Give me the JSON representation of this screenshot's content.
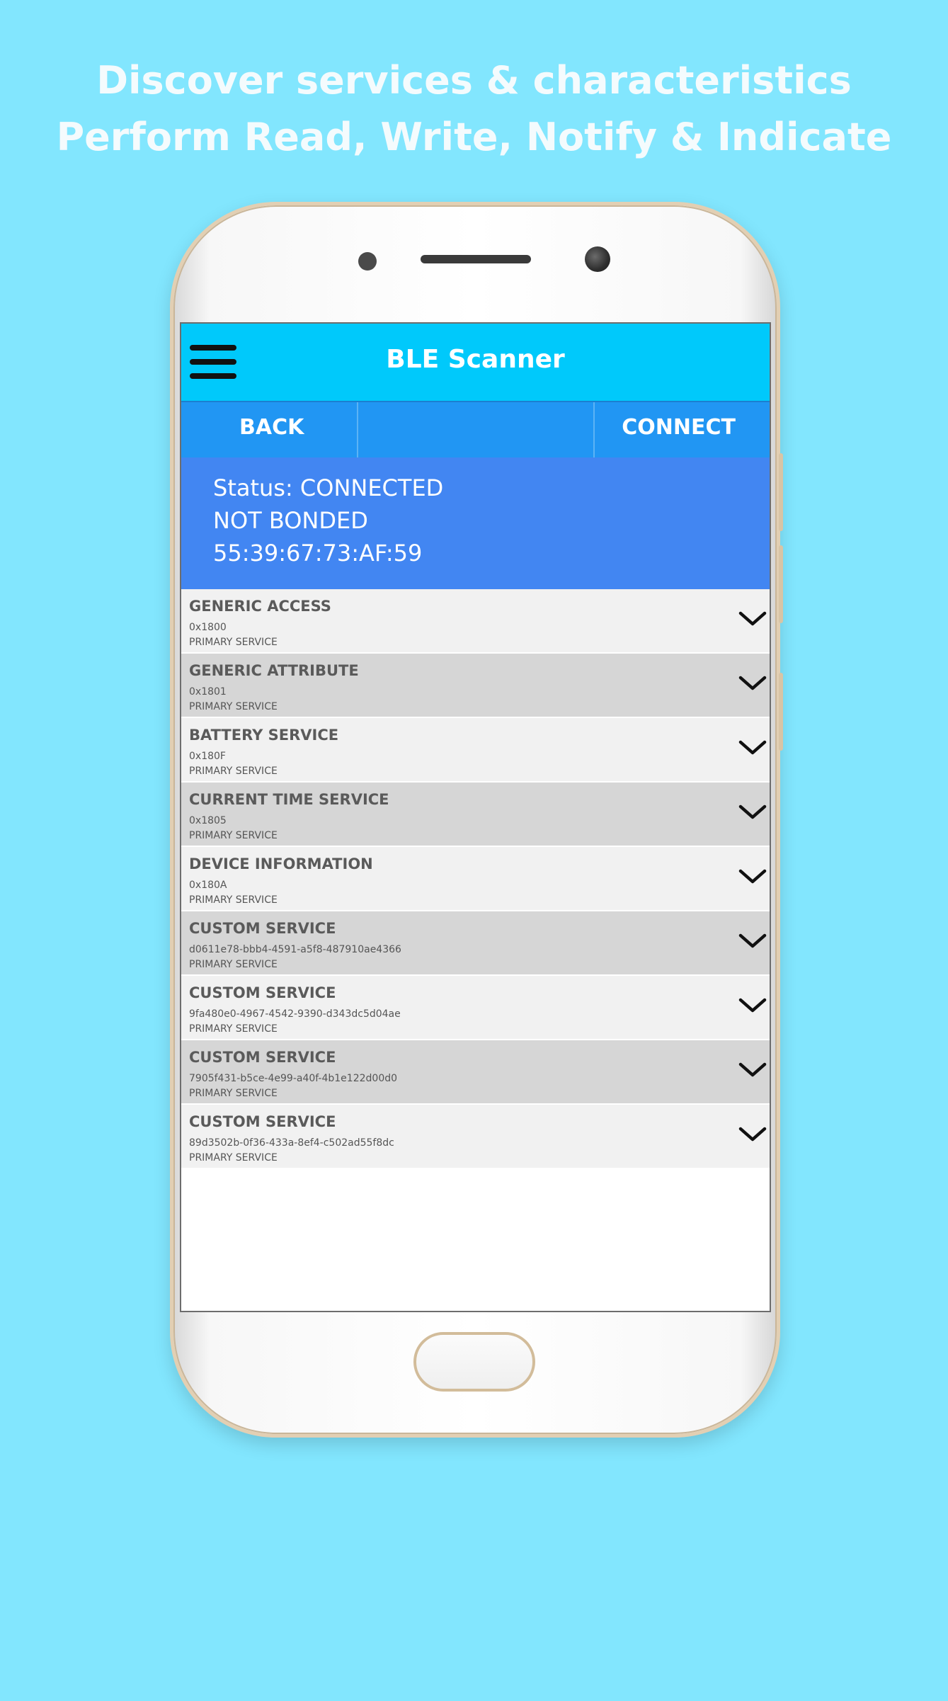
{
  "promo": {
    "line1": "Discover services & characteristics",
    "line2": "Perform Read, Write, Notify & Indicate"
  },
  "app": {
    "title": "BLE Scanner",
    "back_label": "BACK",
    "connect_label": "CONNECT"
  },
  "status": {
    "state": "Status: CONNECTED",
    "bond": "NOT BONDED",
    "address": "55:39:67:73:AF:59"
  },
  "services": [
    {
      "name": "GENERIC ACCESS",
      "uuid": "0x1800",
      "type": "PRIMARY SERVICE"
    },
    {
      "name": "GENERIC ATTRIBUTE",
      "uuid": "0x1801",
      "type": "PRIMARY SERVICE"
    },
    {
      "name": "BATTERY SERVICE",
      "uuid": "0x180F",
      "type": "PRIMARY SERVICE"
    },
    {
      "name": "CURRENT TIME SERVICE",
      "uuid": "0x1805",
      "type": "PRIMARY SERVICE"
    },
    {
      "name": "DEVICE INFORMATION",
      "uuid": "0x180A",
      "type": "PRIMARY SERVICE"
    },
    {
      "name": "CUSTOM SERVICE",
      "uuid": "d0611e78-bbb4-4591-a5f8-487910ae4366",
      "type": "PRIMARY SERVICE"
    },
    {
      "name": "CUSTOM SERVICE",
      "uuid": "9fa480e0-4967-4542-9390-d343dc5d04ae",
      "type": "PRIMARY SERVICE"
    },
    {
      "name": "CUSTOM SERVICE",
      "uuid": "7905f431-b5ce-4e99-a40f-4b1e122d00d0",
      "type": "PRIMARY SERVICE"
    },
    {
      "name": "CUSTOM SERVICE",
      "uuid": "89d3502b-0f36-433a-8ef4-c502ad55f8dc",
      "type": "PRIMARY SERVICE"
    }
  ],
  "icons": {
    "menu": "hamburger-menu-icon",
    "expand": "chevron-down-icon"
  },
  "colors": {
    "background": "#82e6fe",
    "appbar": "#00c9fb",
    "actionbar": "#2196f3",
    "status_panel": "#4286f2"
  }
}
